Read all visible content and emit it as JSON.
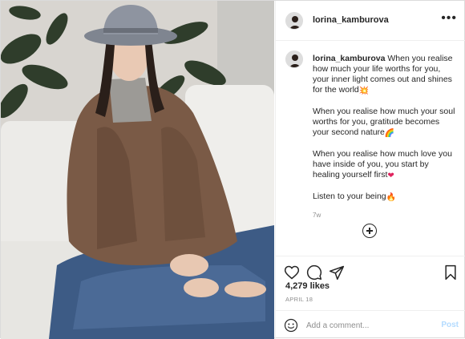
{
  "post": {
    "username": "lorina_kamburova",
    "more_icon": "more-horizontal-icon",
    "caption_paragraphs": [
      {
        "text": "When you realise how much your life worths for you, your inner light comes out and shines for the world",
        "emoji": "💥"
      },
      {
        "text": "When you realise how much your soul worths for you, gratitude becomes your second nature",
        "emoji": "🌈"
      },
      {
        "text": "When you realise how much love you have inside of you, you start by healing yourself first",
        "emoji": "❤"
      },
      {
        "text": "Listen to your being",
        "emoji": "🔥"
      }
    ],
    "time_ago": "7w",
    "likes": "4,279 likes",
    "date": "APRIL 18",
    "comment_placeholder": "Add a comment...",
    "post_label": "Post",
    "colors": {
      "text": "#262626",
      "secondary": "#8e8e8e",
      "border": "#efefef",
      "post_disabled": "#b3dbff",
      "heart_emoji": "#e0245e"
    }
  }
}
